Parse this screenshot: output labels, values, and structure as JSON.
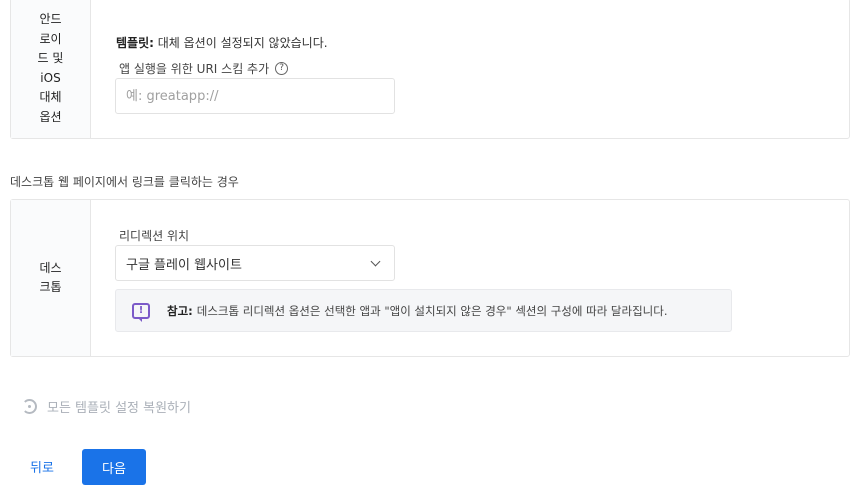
{
  "android_ios": {
    "label": "안드\n로이\n드 및\niOS\n대체\n옵션",
    "template_title": "템플릿:",
    "template_text": "대체 옵션이 설정되지 않았습니다.",
    "uri_label": "앱 실행을 위한 URI 스킴 추가",
    "help_icon": "?",
    "uri_placeholder": "예: greatapp://",
    "uri_value": ""
  },
  "desktop_heading": "데스크톱 웹 페이지에서 링크를 클릭하는 경우",
  "desktop": {
    "label": "데스\n크톱",
    "redirect_label": "리디렉션 위치",
    "redirect_value": "구글 플레이 웹사이트",
    "note_icon": "!",
    "note_title": "참고:",
    "note_text": "데스크톱 리디렉션 옵션은 선택한 앱과 \"앱이 설치되지 않은 경우\" 섹션의 구성에 따라 달라집니다."
  },
  "restore_label": "모든 템플릿 설정 복원하기",
  "buttons": {
    "back": "뒤로",
    "next": "다음"
  },
  "colors": {
    "accent": "#1a73e8",
    "note_icon": "#7b5ac8"
  }
}
